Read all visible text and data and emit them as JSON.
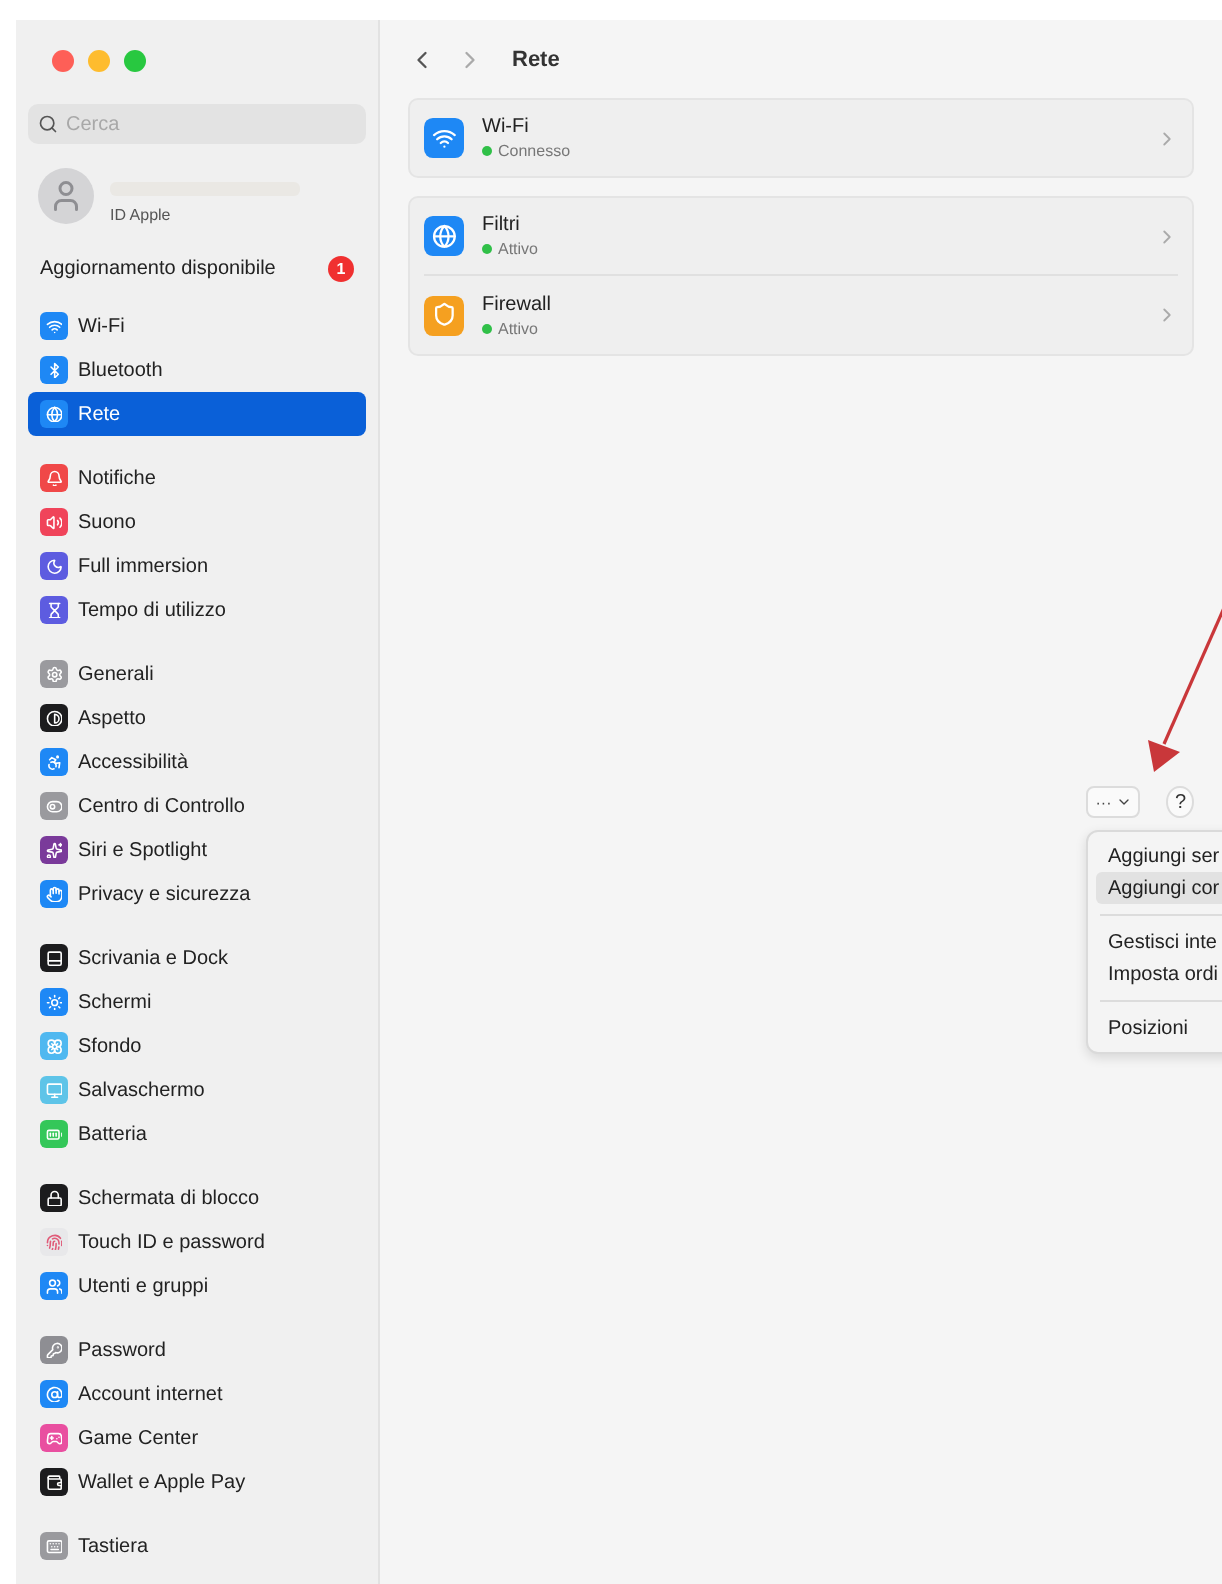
{
  "sidebar": {
    "search": {
      "placeholder": "Cerca"
    },
    "account": {
      "label": "ID Apple"
    },
    "update": {
      "label": "Aggiornamento disponibile",
      "badge": "1"
    },
    "groups": [
      [
        {
          "label": "Wi-Fi",
          "kind": "wifi",
          "color": "#1e88f5",
          "selected": false
        },
        {
          "label": "Bluetooth",
          "kind": "bluetooth",
          "color": "#1e88f5",
          "selected": false
        },
        {
          "label": "Rete",
          "kind": "globe",
          "color": "#1e88f5",
          "selected": true
        }
      ],
      [
        {
          "label": "Notifiche",
          "kind": "bell",
          "color": "#f04848",
          "selected": false
        },
        {
          "label": "Suono",
          "kind": "volume",
          "color": "#f0445a",
          "selected": false
        },
        {
          "label": "Full immersion",
          "kind": "moon",
          "color": "#5d5ce0",
          "selected": false
        },
        {
          "label": "Tempo di utilizzo",
          "kind": "hourglass",
          "color": "#5d5ce0",
          "selected": false
        }
      ],
      [
        {
          "label": "Generali",
          "kind": "gear",
          "color": "#9a9a9e",
          "selected": false
        },
        {
          "label": "Aspetto",
          "kind": "contrast",
          "color": "#1c1c1e",
          "selected": false
        },
        {
          "label": "Accessibilità",
          "kind": "accessibility",
          "color": "#1e88f5",
          "selected": false
        },
        {
          "label": "Centro di Controllo",
          "kind": "toggles",
          "color": "#9a9a9e",
          "selected": false
        },
        {
          "label": "Siri e Spotlight",
          "kind": "sparkles",
          "color": "#7a3a9a",
          "selected": false
        },
        {
          "label": "Privacy e sicurezza",
          "kind": "hand",
          "color": "#1e88f5",
          "selected": false
        }
      ],
      [
        {
          "label": "Scrivania e Dock",
          "kind": "dock",
          "color": "#1c1c1e",
          "selected": false
        },
        {
          "label": "Schermi",
          "kind": "sun",
          "color": "#1e88f5",
          "selected": false
        },
        {
          "label": "Sfondo",
          "kind": "flower",
          "color": "#4fb8f0",
          "selected": false
        },
        {
          "label": "Salvaschermo",
          "kind": "monitor",
          "color": "#5ec4e8",
          "selected": false
        },
        {
          "label": "Batteria",
          "kind": "battery",
          "color": "#34c759",
          "selected": false
        }
      ],
      [
        {
          "label": "Schermata di blocco",
          "kind": "lock",
          "color": "#1c1c1e",
          "selected": false
        },
        {
          "label": "Touch ID e password",
          "kind": "fingerprint",
          "color": "#e8e8ea",
          "selected": false
        },
        {
          "label": "Utenti e gruppi",
          "kind": "users",
          "color": "#1e88f5",
          "selected": false
        }
      ],
      [
        {
          "label": "Password",
          "kind": "key",
          "color": "#8e8e93",
          "selected": false
        },
        {
          "label": "Account internet",
          "kind": "at",
          "color": "#1e88f5",
          "selected": false
        },
        {
          "label": "Game Center",
          "kind": "gamepad",
          "color": "#e94fa0",
          "selected": false
        },
        {
          "label": "Wallet e Apple Pay",
          "kind": "wallet",
          "color": "#1c1c1e",
          "selected": false
        }
      ],
      [
        {
          "label": "Tastiera",
          "kind": "keyboard",
          "color": "#9a9a9e",
          "selected": false
        }
      ]
    ]
  },
  "main": {
    "title": "Rete",
    "cards": [
      [
        {
          "title": "Wi-Fi",
          "status": {
            "text": "Connesso",
            "color": "#30c048"
          },
          "kind": "wifi",
          "color": "#1e88f5"
        }
      ],
      [
        {
          "title": "Filtri",
          "status": {
            "text": "Attivo",
            "color": "#30c048"
          },
          "kind": "globe",
          "color": "#1e88f5"
        },
        {
          "title": "Firewall",
          "status": {
            "text": "Attivo",
            "color": "#30c048"
          },
          "kind": "shield",
          "color": "#f5a020"
        }
      ]
    ],
    "actions_button": "···",
    "help_button": "?",
    "menu": [
      [
        {
          "label": "Aggiungi ser",
          "selected": false
        },
        {
          "label": "Aggiungi cor",
          "selected": true
        }
      ],
      [
        {
          "label": "Gestisci inte",
          "selected": false
        },
        {
          "label": "Imposta ordi",
          "selected": false
        }
      ],
      [
        {
          "label": "Posizioni",
          "selected": false
        }
      ]
    ]
  }
}
